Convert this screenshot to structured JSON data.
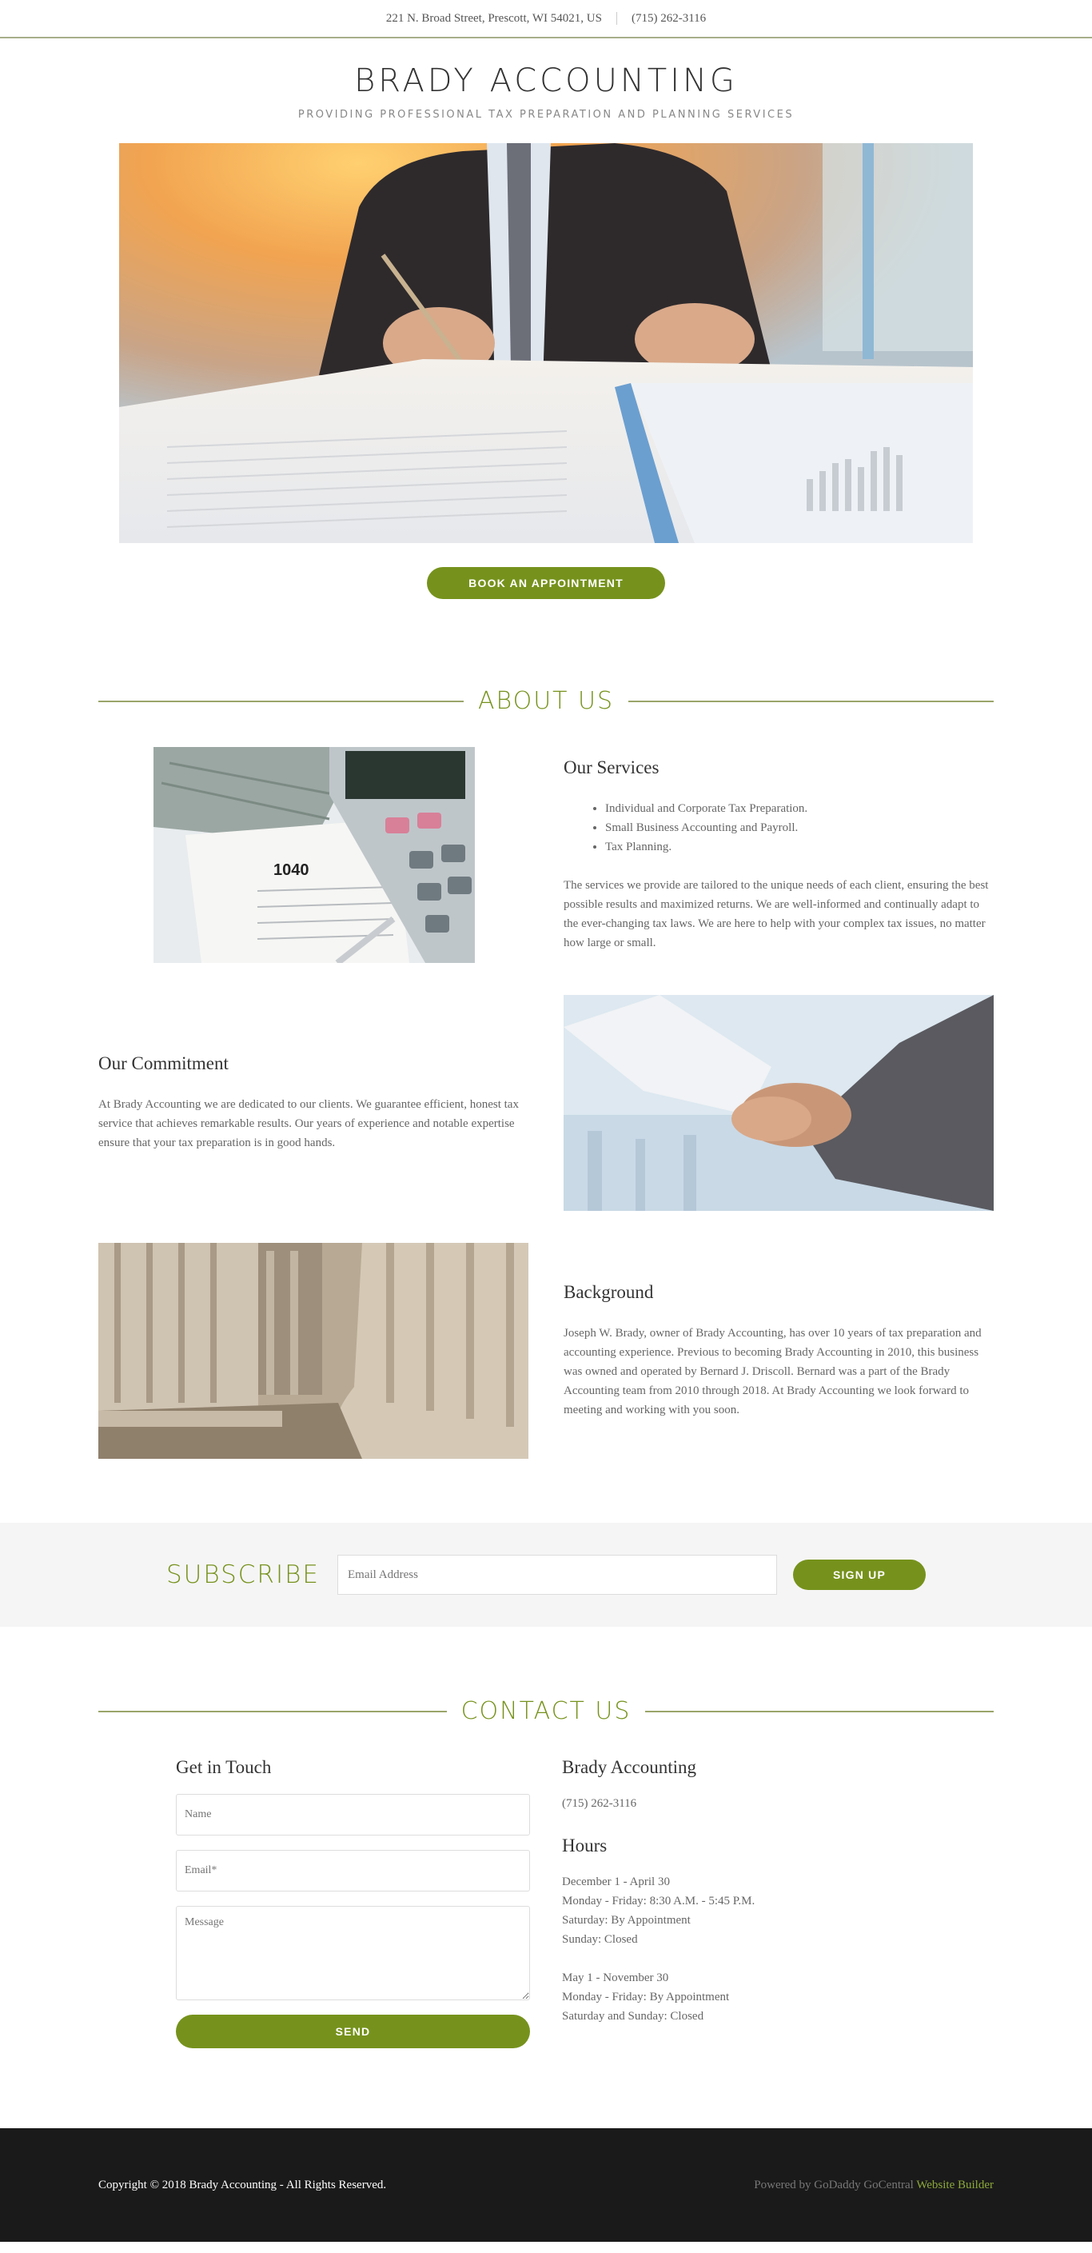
{
  "topbar": {
    "address": "221 N. Broad Street, Prescott, WI 54021, US",
    "phone": "(715) 262-3116"
  },
  "header": {
    "title": "BRADY ACCOUNTING",
    "tagline": "PROVIDING PROFESSIONAL TAX PREPARATION AND PLANNING SERVICES"
  },
  "hero": {
    "cta": "BOOK AN APPOINTMENT"
  },
  "about": {
    "heading": "ABOUT US",
    "services": {
      "title": "Our Services",
      "items": [
        "Individual and Corporate Tax Preparation.",
        "Small Business Accounting and Payroll.",
        "Tax Planning."
      ],
      "text": "The services we provide are tailored to the unique needs of each client, ensuring the best possible results and maximized returns. We are well-informed and continually adapt to the ever-changing tax laws.  We are here to help with your complex tax issues, no matter how large or small."
    },
    "commitment": {
      "title": "Our Commitment",
      "text": "At Brady Accounting we are dedicated to our clients.  We guarantee efficient, honest tax service that achieves remarkable results.  Our years of experience and notable expertise ensure that your tax preparation is in good hands."
    },
    "background": {
      "title": "Background",
      "text": "Joseph W. Brady, owner of Brady Accounting, has over 10 years of tax preparation and accounting experience.  Previous to becoming Brady Accounting in 2010, this business was owned and operated by Bernard J. Driscoll.  Bernard was a part of the Brady Accounting team from 2010 through 2018.  At Brady Accounting we look forward to meeting and working with you soon."
    }
  },
  "subscribe": {
    "heading": "SUBSCRIBE",
    "placeholder": "Email Address",
    "button": "SIGN UP"
  },
  "contact": {
    "heading": "CONTACT US",
    "form": {
      "title": "Get in Touch",
      "name_placeholder": "Name",
      "email_placeholder": "Email*",
      "message_placeholder": "Message",
      "button": "SEND"
    },
    "info": {
      "business": "Brady Accounting",
      "phone": "(715) 262-3116",
      "hours_title": "Hours",
      "hours": [
        "December 1 - April 30",
        "Monday - Friday: 8:30 A.M. - 5:45 P.M.",
        "Saturday:  By Appointment",
        "Sunday: Closed",
        "",
        "May 1 - November 30",
        "Monday - Friday: By Appointment",
        "Saturday and Sunday: Closed"
      ]
    }
  },
  "footer": {
    "copyright": "Copyright © 2018 Brady Accounting - All Rights Reserved.",
    "powered_prefix": "Powered by GoDaddy GoCentral ",
    "powered_link": "Website Builder"
  }
}
